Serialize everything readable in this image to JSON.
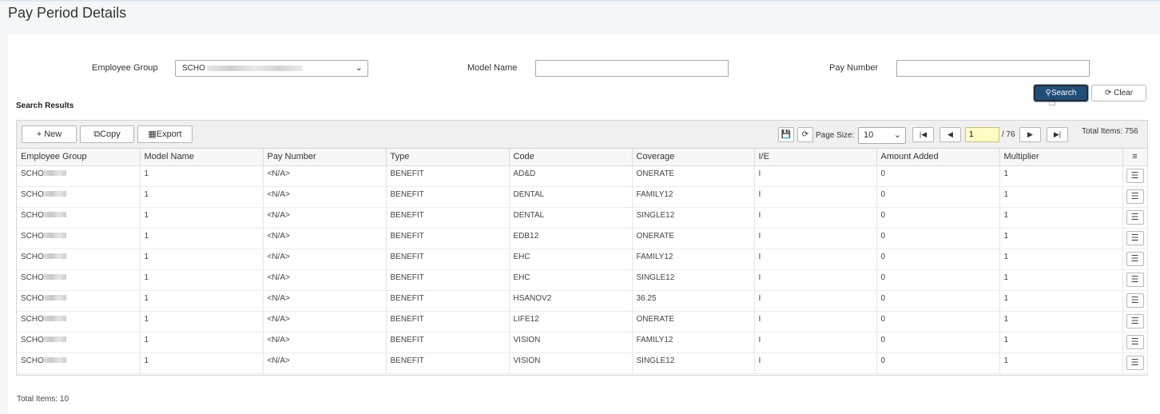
{
  "page": {
    "title": "Pay Period Details"
  },
  "filters": {
    "employee_group_label": "Employee Group",
    "employee_group_value": "SCHO",
    "model_name_label": "Model Name",
    "model_name_value": "",
    "pay_number_label": "Pay Number",
    "pay_number_value": ""
  },
  "buttons": {
    "search": "Search",
    "clear": "Clear"
  },
  "results": {
    "label": "Search Results"
  },
  "toolbar": {
    "new": "New",
    "copy": "Copy",
    "export": "Export",
    "page_size_label": "Page Size:",
    "page_size": "10",
    "current_page": "1",
    "total_pages": "/ 76",
    "total_items": "Total Items: 756"
  },
  "columns": [
    "Employee Group",
    "Model Name",
    "Pay Number",
    "Type",
    "Code",
    "Coverage",
    "I/E",
    "Amount Added",
    "Multiplier"
  ],
  "rows": [
    {
      "group": "SCHO",
      "model": "1",
      "pay": "<N/A>",
      "type": "BENEFIT",
      "code": "AD&D",
      "coverage": "ONERATE",
      "ie": "I",
      "amount": "0",
      "mult": "1"
    },
    {
      "group": "SCHO",
      "model": "1",
      "pay": "<N/A>",
      "type": "BENEFIT",
      "code": "DENTAL",
      "coverage": "FAMILY12",
      "ie": "I",
      "amount": "0",
      "mult": "1"
    },
    {
      "group": "SCHO",
      "model": "1",
      "pay": "<N/A>",
      "type": "BENEFIT",
      "code": "DENTAL",
      "coverage": "SINGLE12",
      "ie": "I",
      "amount": "0",
      "mult": "1"
    },
    {
      "group": "SCHO",
      "model": "1",
      "pay": "<N/A>",
      "type": "BENEFIT",
      "code": "EDB12",
      "coverage": "ONERATE",
      "ie": "I",
      "amount": "0",
      "mult": "1"
    },
    {
      "group": "SCHO",
      "model": "1",
      "pay": "<N/A>",
      "type": "BENEFIT",
      "code": "EHC",
      "coverage": "FAMILY12",
      "ie": "I",
      "amount": "0",
      "mult": "1"
    },
    {
      "group": "SCHO",
      "model": "1",
      "pay": "<N/A>",
      "type": "BENEFIT",
      "code": "EHC",
      "coverage": "SINGLE12",
      "ie": "I",
      "amount": "0",
      "mult": "1"
    },
    {
      "group": "SCHO",
      "model": "1",
      "pay": "<N/A>",
      "type": "BENEFIT",
      "code": "HSANOV2",
      "coverage": "36.25",
      "ie": "I",
      "amount": "0",
      "mult": "1"
    },
    {
      "group": "SCHO",
      "model": "1",
      "pay": "<N/A>",
      "type": "BENEFIT",
      "code": "LIFE12",
      "coverage": "ONERATE",
      "ie": "I",
      "amount": "0",
      "mult": "1"
    },
    {
      "group": "SCHO",
      "model": "1",
      "pay": "<N/A>",
      "type": "BENEFIT",
      "code": "VISION",
      "coverage": "FAMILY12",
      "ie": "I",
      "amount": "0",
      "mult": "1"
    },
    {
      "group": "SCHO",
      "model": "1",
      "pay": "<N/A>",
      "type": "BENEFIT",
      "code": "VISION",
      "coverage": "SINGLE12",
      "ie": "I",
      "amount": "0",
      "mult": "1"
    }
  ],
  "footer": {
    "total_items": "Total Items: 10"
  },
  "icons": {
    "search": "search-icon",
    "refresh": "refresh-icon",
    "save": "save-icon",
    "first": "first-page-icon",
    "prev": "prev-page-icon",
    "next": "next-page-icon",
    "last": "last-page-icon",
    "menu": "hamburger-icon",
    "row_menu": "list-icon"
  }
}
